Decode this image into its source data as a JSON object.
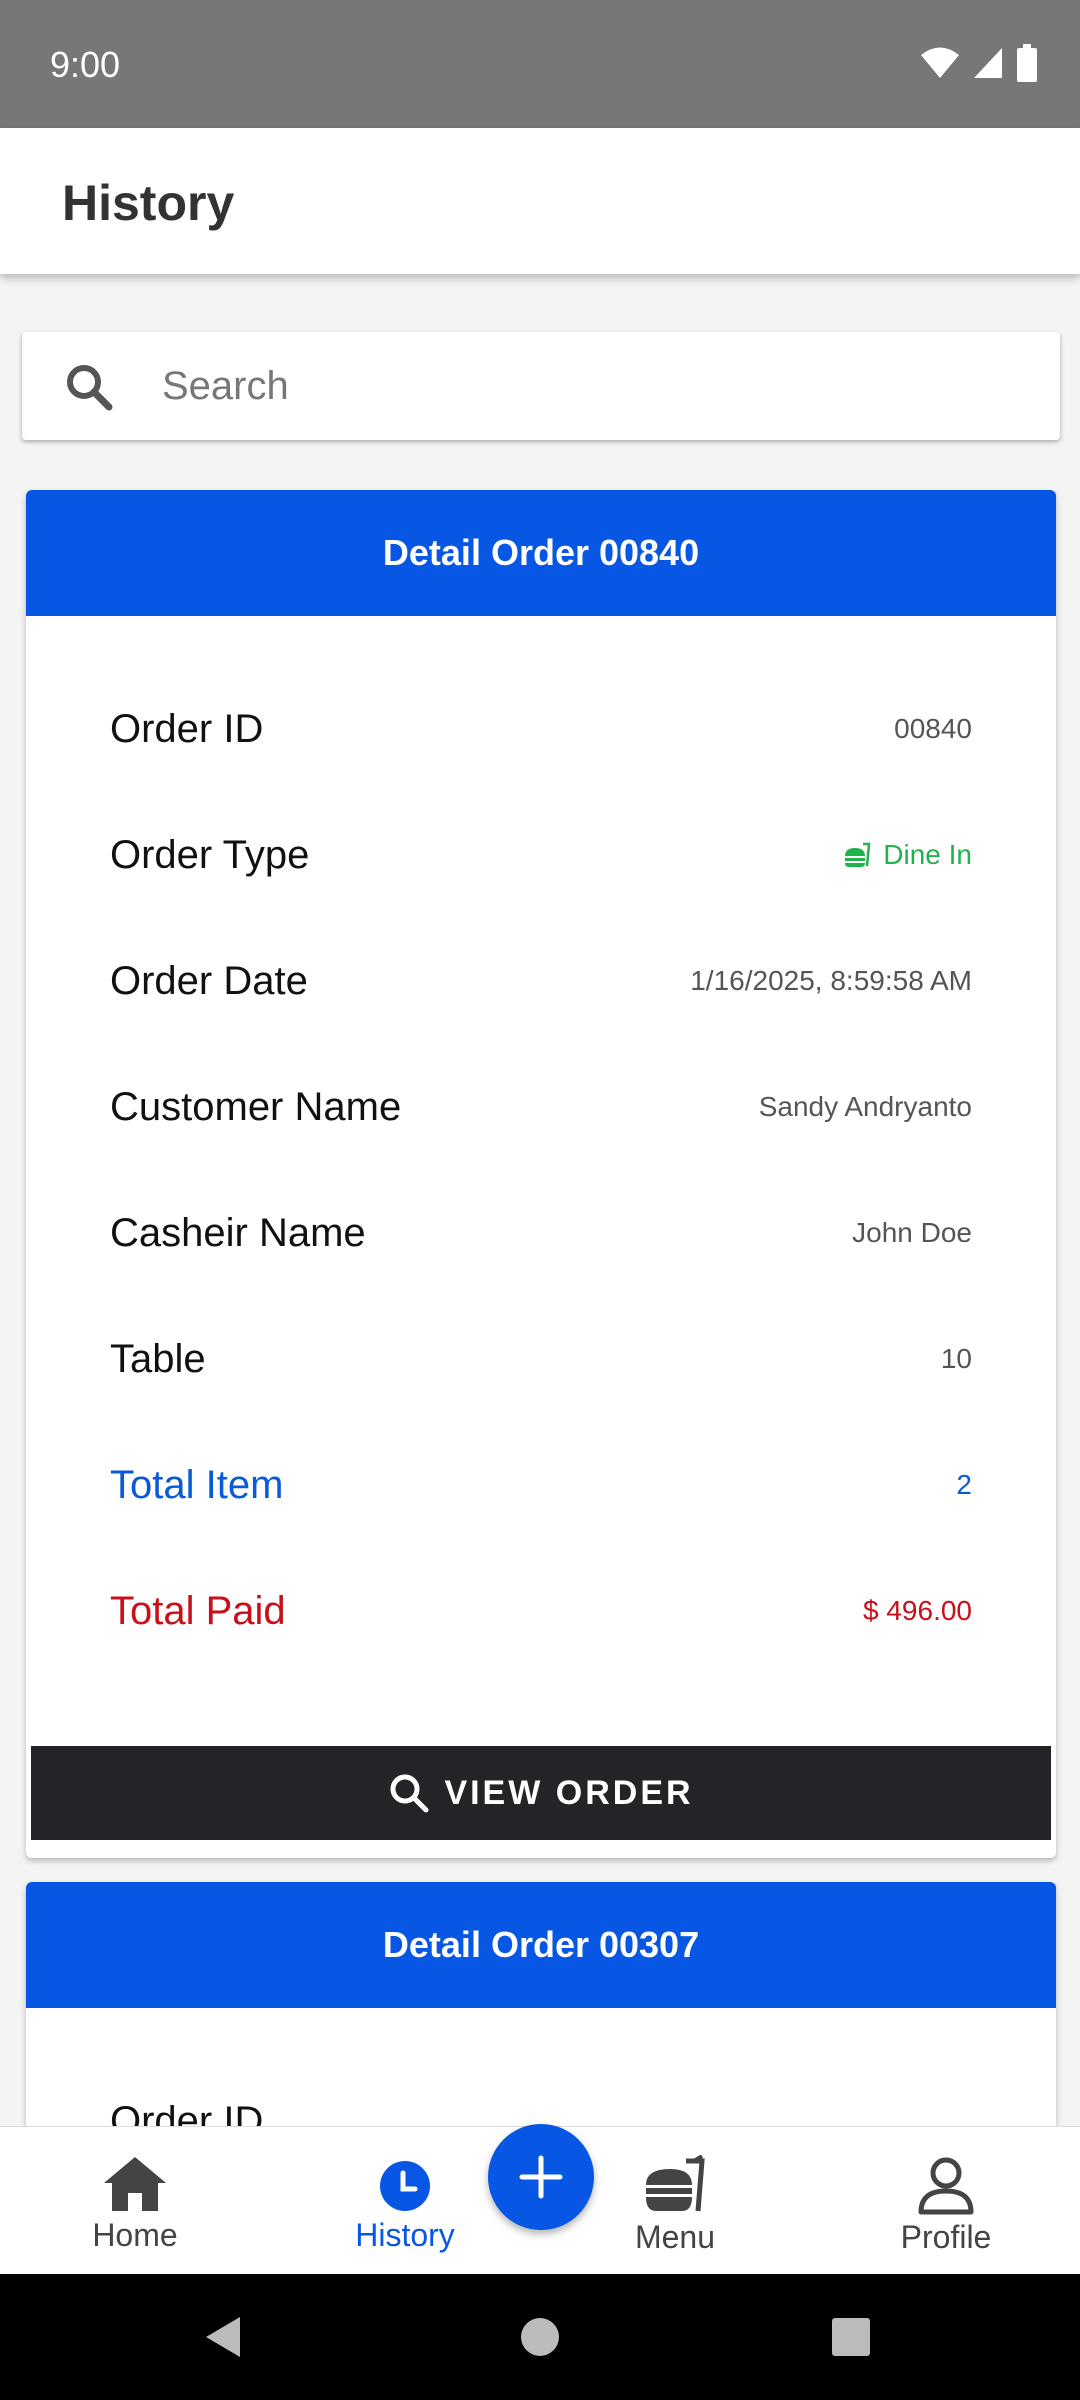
{
  "status_bar": {
    "time": "9:00"
  },
  "app_bar": {
    "title": "History"
  },
  "search": {
    "placeholder": "Search",
    "value": ""
  },
  "orders": [
    {
      "header": "Detail Order 00840",
      "rows": [
        {
          "label": "Order ID",
          "value": "00840"
        },
        {
          "label": "Order Type",
          "value": "Dine In",
          "icon": "dine-in-icon"
        },
        {
          "label": "Order Date",
          "value": "1/16/2025, 8:59:58 AM"
        },
        {
          "label": "Customer Name",
          "value": "Sandy Andryanto"
        },
        {
          "label": "Casheir Name",
          "value": "John Doe"
        },
        {
          "label": "Table",
          "value": "10"
        },
        {
          "label": "Total Item",
          "value": "2"
        },
        {
          "label": "Total Paid",
          "value": "$ 496.00"
        }
      ],
      "button": "VIEW ORDER"
    },
    {
      "header": "Detail Order 00307",
      "rows": [
        {
          "label": "Order ID",
          "value": ""
        }
      ]
    }
  ],
  "bottom_nav": {
    "items": [
      {
        "label": "Home",
        "icon": "home-icon"
      },
      {
        "label": "History",
        "icon": "history-icon",
        "active": true
      },
      {
        "label": "Menu",
        "icon": "menu-food-icon"
      },
      {
        "label": "Profile",
        "icon": "profile-icon"
      }
    ],
    "fab_icon": "plus-icon"
  },
  "colors": {
    "primary": "#0757e4",
    "status_bar": "#777777",
    "dine_in_green": "#22b24c",
    "total_item_blue": "#0a5ad6",
    "total_paid_red": "#c8101a",
    "button_dark": "#232428"
  }
}
